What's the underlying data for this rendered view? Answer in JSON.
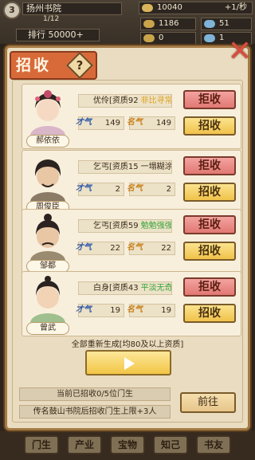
{
  "hud": {
    "level": "3",
    "city_name": "扬州书院",
    "city_progress": "1/12",
    "rank": "排行 50000+",
    "coins": "10040",
    "coin_rate": "+1/秒",
    "res2": "1186",
    "res3": "51",
    "res4": "0",
    "res5": "1"
  },
  "bottom_tabs": [
    "门生",
    "产业",
    "宝物",
    "知己",
    "书友"
  ],
  "dialog": {
    "title": "招收",
    "help": "?",
    "close": "✕",
    "stat_label_a": "才气",
    "stat_label_b": "名气",
    "reject_label": "拒收",
    "accept_label": "招收",
    "regen_text": "全部重新生成[均80及以上资质]",
    "current_status": "当前已招收0/5位门生",
    "bonus_text": "传名鼓山书院后招收门生上限+3人",
    "go_label": "前往"
  },
  "candidates": [
    {
      "name": "郝依依",
      "role": "优伶[资质92",
      "tag": "非比寻常]",
      "tag_color": "#e0a21e",
      "stat_a": "149",
      "stat_b": "149"
    },
    {
      "name": "周俊臣",
      "role": "乞丐[资质15",
      "tag": "一塌糊涂]",
      "tag_color": "#3b2a1a",
      "stat_a": "2",
      "stat_b": "2"
    },
    {
      "name": "邹都",
      "role": "乞丐[资质59",
      "tag": "勉勉强强]",
      "tag_color": "#3aa33a",
      "stat_a": "22",
      "stat_b": "22"
    },
    {
      "name": "曾武",
      "role": "白身[资质43",
      "tag": "平淡无奇]",
      "tag_color": "#3aa33a",
      "stat_a": "19",
      "stat_b": "19"
    }
  ]
}
